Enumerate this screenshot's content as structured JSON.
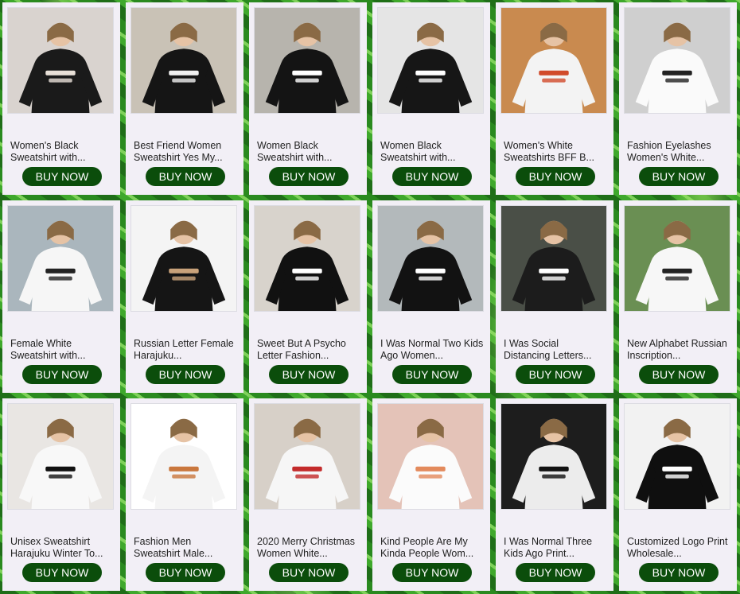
{
  "products": [
    {
      "title": "Women's Black Sweatshirt with...",
      "button": "BUY NOW",
      "colors": {
        "bg": "#d9d3cf",
        "shirt": "#1a1a1a",
        "accent": "#e8e0d8"
      }
    },
    {
      "title": "Best Friend Women Sweatshirt Yes My...",
      "button": "BUY NOW",
      "colors": {
        "bg": "#c9c2b6",
        "shirt": "#151515",
        "accent": "#f0f0f0"
      }
    },
    {
      "title": "Women Black Sweatshirt with...",
      "button": "BUY NOW",
      "colors": {
        "bg": "#b7b4ad",
        "shirt": "#141414",
        "accent": "#ffffff"
      }
    },
    {
      "title": "Women Black Sweatshirt with...",
      "button": "BUY NOW",
      "colors": {
        "bg": "#e5e5e5",
        "shirt": "#161616",
        "accent": "#ffffff"
      }
    },
    {
      "title": "Women's White Sweatshirts BFF B...",
      "button": "BUY NOW",
      "colors": {
        "bg": "#c98a4f",
        "shirt": "#f3f3f3",
        "accent": "#d14a2a"
      }
    },
    {
      "title": "Fashion Eyelashes Women's White...",
      "button": "BUY NOW",
      "colors": {
        "bg": "#cfcfcf",
        "shirt": "#fafafa",
        "accent": "#222222"
      }
    },
    {
      "title": "Female White Sweatshirt with...",
      "button": "BUY NOW",
      "colors": {
        "bg": "#aab6bd",
        "shirt": "#f6f6f6",
        "accent": "#222222"
      }
    },
    {
      "title": "Russian Letter Female Harajuku...",
      "button": "BUY NOW",
      "colors": {
        "bg": "#f4f4f4",
        "shirt": "#151515",
        "accent": "#c9a27a"
      }
    },
    {
      "title": "Sweet But A Psycho Letter Fashion...",
      "button": "BUY NOW",
      "colors": {
        "bg": "#d8d3cc",
        "shirt": "#111111",
        "accent": "#ffffff"
      }
    },
    {
      "title": "I Was Normal Two Kids Ago Women...",
      "button": "BUY NOW",
      "colors": {
        "bg": "#b3b9bb",
        "shirt": "#121212",
        "accent": "#ffffff"
      }
    },
    {
      "title": "I Was Social Distancing Letters...",
      "button": "BUY NOW",
      "colors": {
        "bg": "#4a4f47",
        "shirt": "#1c1c1c",
        "accent": "#ffffff"
      }
    },
    {
      "title": "New Alphabet Russian Inscription...",
      "button": "BUY NOW",
      "colors": {
        "bg": "#6a8f53",
        "shirt": "#f7f7f7",
        "accent": "#222222"
      }
    },
    {
      "title": "Unisex Sweatshirt Harajuku Winter To...",
      "button": "BUY NOW",
      "colors": {
        "bg": "#e9e6e3",
        "shirt": "#f8f8f8",
        "accent": "#111111"
      }
    },
    {
      "title": "Fashion Men Sweatshirt Male...",
      "button": "BUY NOW",
      "colors": {
        "bg": "#ffffff",
        "shirt": "#f4f4f4",
        "accent": "#c9773d"
      }
    },
    {
      "title": "2020 Merry Christmas Women White...",
      "button": "BUY NOW",
      "colors": {
        "bg": "#d7d0c8",
        "shirt": "#f6f6f6",
        "accent": "#c32b2b"
      }
    },
    {
      "title": "Kind People Are My Kinda People Wom...",
      "button": "BUY NOW",
      "colors": {
        "bg": "#e4c3b8",
        "shirt": "#fbfbfb",
        "accent": "#e38a5c"
      }
    },
    {
      "title": "I Was Normal Three Kids Ago Print...",
      "button": "BUY NOW",
      "colors": {
        "bg": "#1d1d1d",
        "shirt": "#ececec",
        "accent": "#111111"
      }
    },
    {
      "title": "Customized Logo Print Wholesale...",
      "button": "BUY NOW",
      "colors": {
        "bg": "#f2f2f2",
        "shirt": "#0f0f0f",
        "accent": "#ffffff"
      }
    }
  ]
}
